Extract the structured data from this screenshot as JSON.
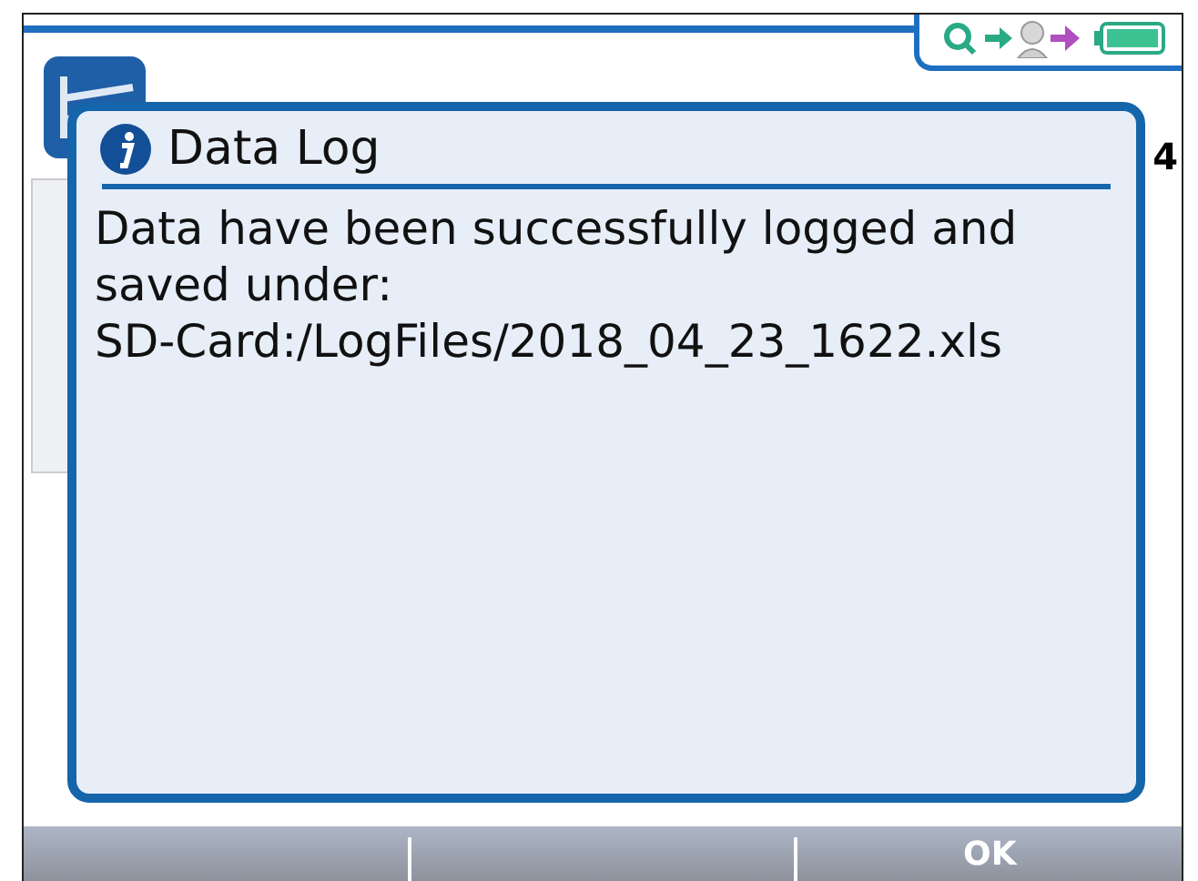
{
  "app": {
    "corner_text": "4"
  },
  "dialog": {
    "title": "Data Log",
    "message": "Data have been successfully logged and saved under:",
    "path": "SD-Card:/LogFiles/2018_04_23_1622.xls"
  },
  "softkeys": [
    "OK"
  ]
}
